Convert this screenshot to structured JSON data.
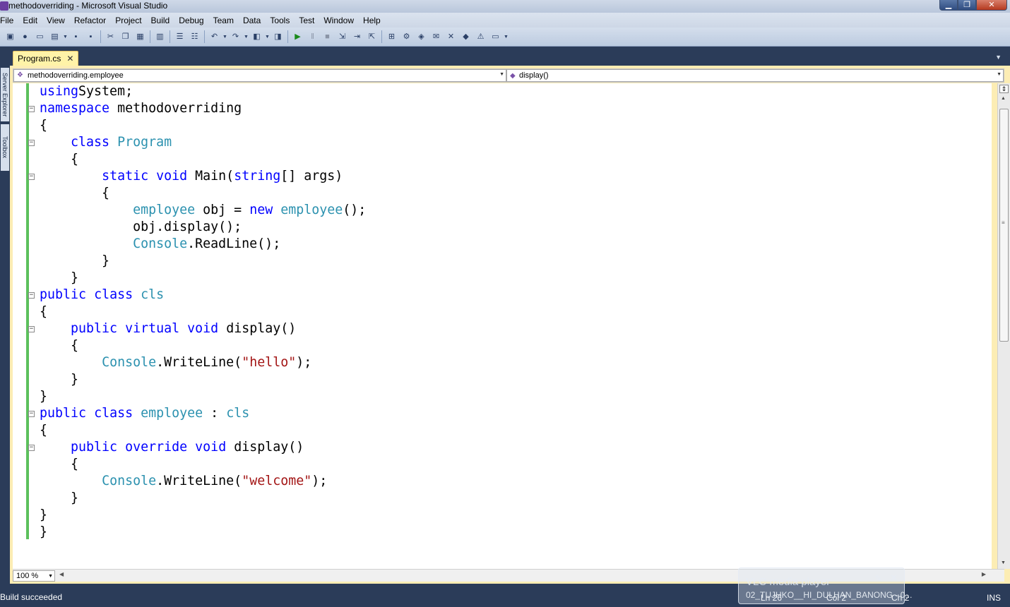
{
  "window": {
    "title": "methodoverriding - Microsoft Visual Studio",
    "buttons": {
      "minimize": "▁",
      "maximize": "❐",
      "close": "✕"
    }
  },
  "menu": [
    "File",
    "Edit",
    "View",
    "Refactor",
    "Project",
    "Build",
    "Debug",
    "Team",
    "Data",
    "Tools",
    "Test",
    "Window",
    "Help"
  ],
  "toolbar": {
    "icons": [
      "new-project-icon",
      "add-item-icon",
      "open-file-icon",
      "add-new-item-icon",
      "save-icon",
      "save-all-icon",
      "cut-icon",
      "copy-icon",
      "paste-icon",
      "find-icon",
      "comment-icon",
      "uncomment-icon",
      "undo-icon",
      "redo-icon",
      "navigate-backward-icon",
      "navigate-forward-icon",
      "start-debug-icon",
      "pause-icon",
      "stop-icon",
      "step-into-icon",
      "step-over-icon",
      "step-out-icon",
      "solution-explorer-icon",
      "properties-icon",
      "object-browser-icon",
      "toolbox-icon",
      "class-view-icon",
      "error-list-icon",
      "start-page-icon"
    ]
  },
  "dock": {
    "server_explorer": "Server Explorer",
    "toolbox": "Toolbox"
  },
  "tabs": [
    {
      "label": "Program.cs",
      "close": "✕"
    }
  ],
  "navbar": {
    "type": "methodoverriding.employee",
    "member": "display()"
  },
  "editor": {
    "zoom": "100 %",
    "lines": [
      [
        [
          "kw",
          "using"
        ],
        [
          "",
          "System;"
        ]
      ],
      [
        [
          "kw",
          "namespace"
        ],
        [
          "",
          " methodoverriding"
        ]
      ],
      [
        [
          "",
          "{"
        ]
      ],
      [
        [
          "",
          "    "
        ],
        [
          "kw",
          "class"
        ],
        [
          "",
          " "
        ],
        [
          "ty",
          "Program"
        ]
      ],
      [
        [
          "",
          "    {"
        ]
      ],
      [
        [
          "",
          "        "
        ],
        [
          "kw",
          "static"
        ],
        [
          "",
          " "
        ],
        [
          "kw",
          "void"
        ],
        [
          "",
          " Main("
        ],
        [
          "kw",
          "string"
        ],
        [
          "",
          "[] args)"
        ]
      ],
      [
        [
          "",
          "        {"
        ]
      ],
      [
        [
          "",
          "            "
        ],
        [
          "ty",
          "employee"
        ],
        [
          "",
          " obj = "
        ],
        [
          "kw",
          "new"
        ],
        [
          "",
          " "
        ],
        [
          "ty",
          "employee"
        ],
        [
          "",
          "();"
        ]
      ],
      [
        [
          "",
          "            obj.display();"
        ]
      ],
      [
        [
          "",
          "            "
        ],
        [
          "ty",
          "Console"
        ],
        [
          "",
          ".ReadLine();"
        ]
      ],
      [
        [
          "",
          "        }"
        ]
      ],
      [
        [
          "",
          "    }"
        ]
      ],
      [
        [
          "kw",
          "public"
        ],
        [
          "",
          " "
        ],
        [
          "kw",
          "class"
        ],
        [
          "",
          " "
        ],
        [
          "ty",
          "cls"
        ]
      ],
      [
        [
          "",
          "{"
        ]
      ],
      [
        [
          "",
          "    "
        ],
        [
          "kw",
          "public"
        ],
        [
          "",
          " "
        ],
        [
          "kw",
          "virtual"
        ],
        [
          "",
          " "
        ],
        [
          "kw",
          "void"
        ],
        [
          "",
          " display()"
        ]
      ],
      [
        [
          "",
          "    {"
        ]
      ],
      [
        [
          "",
          "        "
        ],
        [
          "ty",
          "Console"
        ],
        [
          "",
          ".WriteLine("
        ],
        [
          "st",
          "\"hello\""
        ],
        [
          "",
          ");"
        ]
      ],
      [
        [
          "",
          "    }"
        ]
      ],
      [
        [
          "",
          "}"
        ]
      ],
      [
        [
          "kw",
          "public"
        ],
        [
          "",
          " "
        ],
        [
          "kw",
          "class"
        ],
        [
          "",
          " "
        ],
        [
          "ty",
          "employee"
        ],
        [
          "",
          " : "
        ],
        [
          "ty",
          "cls"
        ]
      ],
      [
        [
          "",
          "{"
        ]
      ],
      [
        [
          "",
          "    "
        ],
        [
          "kw",
          "public"
        ],
        [
          "",
          " "
        ],
        [
          "kw",
          "override"
        ],
        [
          "",
          " "
        ],
        [
          "kw",
          "void"
        ],
        [
          "",
          " display()"
        ]
      ],
      [
        [
          "",
          "    {"
        ]
      ],
      [
        [
          "",
          "        "
        ],
        [
          "ty",
          "Console"
        ],
        [
          "",
          ".WriteLine("
        ],
        [
          "st",
          "\"welcome\""
        ],
        [
          "",
          ");"
        ]
      ],
      [
        [
          "",
          "    }"
        ]
      ],
      [
        [
          "",
          "}"
        ]
      ],
      [
        [
          "",
          "}"
        ]
      ]
    ],
    "fold_lines": [
      2,
      4,
      6,
      13,
      15,
      20,
      22
    ]
  },
  "status": {
    "message": "Build succeeded",
    "ln": "Ln 26",
    "col": "Col 2",
    "ch": "Ch 2",
    "mode": "INS"
  },
  "vlc": {
    "title": "VLC media player",
    "track": "02_TUJHKO__HI_DULHAN_BANONG - 0..."
  },
  "colors": {
    "keyword": "#0000ff",
    "type": "#2b91af",
    "string": "#a31515",
    "chrome": "#2b3c59",
    "active_tab": "#fff3a8"
  }
}
